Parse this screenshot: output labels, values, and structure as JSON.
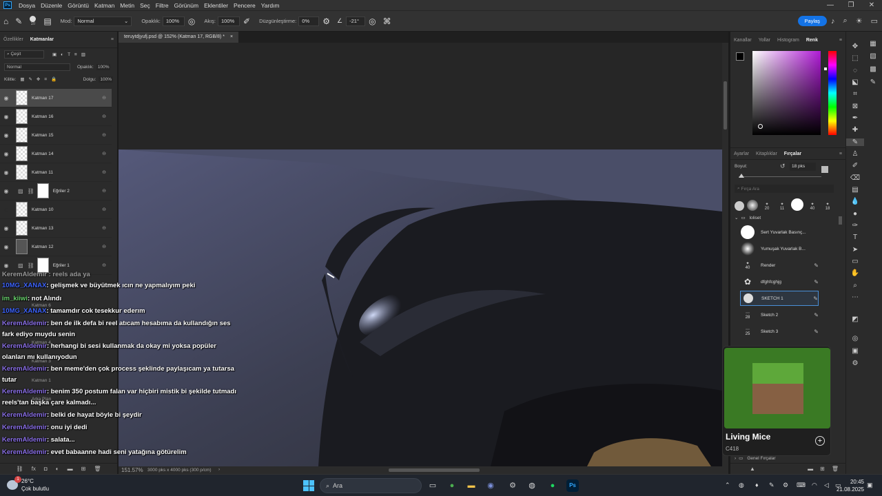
{
  "app": {
    "logo": "Ps",
    "menu": [
      "Dosya",
      "Düzenle",
      "Görüntü",
      "Katman",
      "Metin",
      "Seç",
      "Filtre",
      "Görünüm",
      "Eklentiler",
      "Pencere",
      "Yardım"
    ],
    "window_controls": [
      "—",
      "❐",
      "✕"
    ]
  },
  "options_bar": {
    "mode_label": "Mod:",
    "mode_value": "Normal",
    "opacity_label": "Opaklık:",
    "opacity_value": "100%",
    "flow_label": "Akış:",
    "flow_value": "100%",
    "smoothing_label": "Düzgünleştirme:",
    "smoothing_value": "0%",
    "angle_value": "-21°",
    "brush_size": "10",
    "share_label": "Paylaş"
  },
  "layers_panel": {
    "tabs": [
      "Özellikler",
      "Katmanlar"
    ],
    "filter_label": "Çeşit",
    "blend_mode": "Normal",
    "opacity_label": "Opaklık:",
    "opacity_value": "100%",
    "lock_label": "Kilitle:",
    "fill_label": "Dolgu:",
    "fill_value": "100%",
    "layers": [
      {
        "name": "Katman 17",
        "selected": true,
        "thumb": "checker"
      },
      {
        "name": "Katman 16",
        "selected": false,
        "thumb": "checker"
      },
      {
        "name": "Katman 15",
        "selected": false,
        "thumb": "checker"
      },
      {
        "name": "Katman 14",
        "selected": false,
        "thumb": "checker"
      },
      {
        "name": "Katman 11",
        "selected": false,
        "thumb": "checker"
      },
      {
        "name": "Eğriler 2",
        "selected": false,
        "thumb": "white"
      },
      {
        "name": "Katman 10",
        "selected": false,
        "thumb": "checker"
      },
      {
        "name": "Katman 13",
        "selected": false,
        "thumb": "checker"
      },
      {
        "name": "Katman 12",
        "selected": false,
        "thumb": "checker"
      },
      {
        "name": "Eğriler 1",
        "selected": false,
        "thumb": "white"
      }
    ],
    "hidden_layers": [
      "Katman 6",
      "Katman 4",
      "Katman 3",
      "Katman 1",
      "Arka Plan"
    ]
  },
  "document": {
    "tab_title": "teruytdjyufj.psd @ 152% (Katman 17, RGB/8) *",
    "zoom": "151.57%",
    "doc_info": "3000 pks x 4000 pks (300 p/cm)"
  },
  "color_panel": {
    "tabs": [
      "Kanallar",
      "Yollar",
      "Histogram",
      "Renk"
    ],
    "active_tab": "Renk"
  },
  "brushes_panel": {
    "tabs": [
      "Ayarlar",
      "Kitaplıklar",
      "Fırçalar"
    ],
    "size_label": "Boyut:",
    "size_value": "18 pks",
    "search_placeholder": "Fırça Ara",
    "recent_sizes": [
      "20",
      "11",
      "40",
      "18"
    ],
    "folder_name": "loliset",
    "brushes": [
      {
        "name": "Sert Yuvarlak Basınç...",
        "size": ""
      },
      {
        "name": "Yumuşak Yuvarlak B...",
        "size": ""
      },
      {
        "name": "Render",
        "size": "40"
      },
      {
        "name": "dfghfcghjg",
        "size": ""
      },
      {
        "name": "SKETCH 1",
        "size": ""
      },
      {
        "name": "Sketch 2",
        "size": "28"
      },
      {
        "name": "Sketch 3",
        "size": "25"
      }
    ],
    "bottom_folder": "Genel Fırçalar"
  },
  "chat": {
    "messages": [
      {
        "user": "10MG_XANAX",
        "text": ": gelişmek ve büyütmek ıcın ne yapmalıyım peki",
        "color": "u2"
      },
      {
        "user": "im_kiiwi",
        "text": ": not Alındı",
        "color": "u3"
      },
      {
        "user": "10MG_XANAX",
        "text": ": tamamdır cok tesekkur ederım",
        "color": "u2"
      },
      {
        "user": "KeremAldemir",
        "text": ": ben de ilk defa bi reel atıcam hesabıma da kullandığın ses",
        "color": "u1"
      },
      {
        "user": "",
        "text": "fark ediyo muydu senin",
        "color": ""
      },
      {
        "user": "KeremAldemir",
        "text": ": herhangi bi sesi kullanmak da okay mi yoksa popüler",
        "color": "u1"
      },
      {
        "user": "",
        "text": "olanları mı kullanıyodun",
        "color": ""
      },
      {
        "user": "KeremAldemir",
        "text": ": ben meme'den çok process şeklinde paylaşıcam ya tutarsa",
        "color": "u1"
      },
      {
        "user": "",
        "text": "tutar",
        "color": ""
      },
      {
        "user": "KeremAldemir",
        "text": ": benim 350 postum falan var hiçbiri mistik bi şekilde tutmadı",
        "color": "u1"
      },
      {
        "user": "",
        "text": "reels'tan başka çare kalmadı...",
        "color": ""
      },
      {
        "user": "KeremAldemir",
        "text": ": belki de hayat böyle bi şeydir",
        "color": "u1"
      },
      {
        "user": "KeremAldemir",
        "text": ": onu iyi dedi",
        "color": "u1"
      },
      {
        "user": "KeremAldemir",
        "text": ": salata...",
        "color": "u1"
      },
      {
        "user": "KeremAldemir",
        "text": ": evet babaanne hadi seni yatağına götürelim",
        "color": "u1"
      }
    ]
  },
  "media": {
    "title": "Living Mice",
    "artist": "C418"
  },
  "taskbar": {
    "temperature": "26°C",
    "weather": "Çok bulutlu",
    "search_label": "Ara",
    "time": "20:45",
    "date": "21.08.2025",
    "notification_count": "1"
  },
  "colors": {
    "accent": "#1473e6",
    "panel": "#2b2b2b",
    "canvas": "#3e4251"
  }
}
